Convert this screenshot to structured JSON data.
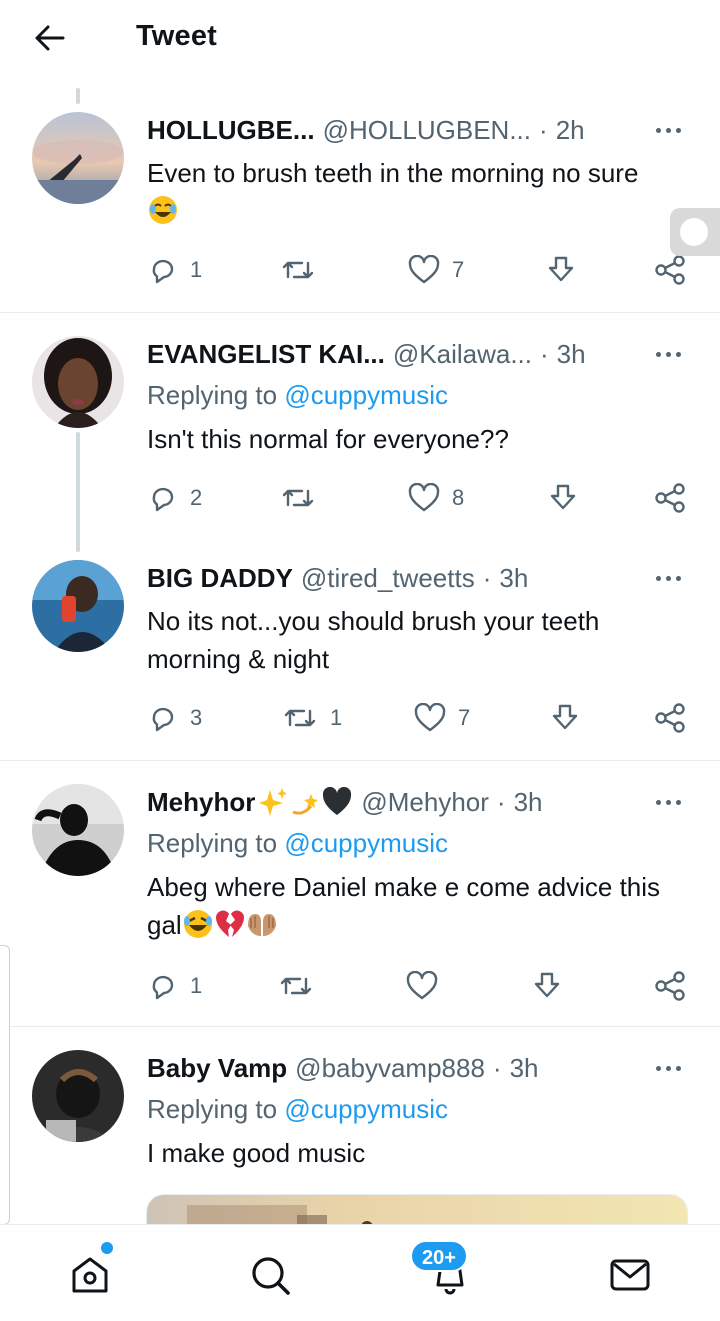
{
  "header": {
    "title": "Tweet"
  },
  "tweets": [
    {
      "name": "HOLLUGBE...",
      "handle": "@HOLLUGBEN...",
      "time": "2h",
      "text": "Even to brush teeth in the morning no sure",
      "emoji": [
        "face-with-tears-of-joy"
      ],
      "replies": "1",
      "retweets": "",
      "likes": "7"
    },
    {
      "name": "EVANGELIST KAI...",
      "handle": "@Kailawa...",
      "time": "3h",
      "replying_prefix": "Replying to",
      "replying_to": "@cuppymusic",
      "text": "Isn't this normal for everyone??",
      "replies": "2",
      "retweets": "",
      "likes": "8"
    },
    {
      "name": "BIG DADDY",
      "handle": "@tired_tweetts",
      "time": "3h",
      "text": "No its not...you should brush your teeth morning & night",
      "replies": "3",
      "retweets": "1",
      "likes": "7"
    },
    {
      "name": "Mehyhor",
      "name_emoji": [
        "sparkles",
        "dizzy",
        "black-heart"
      ],
      "handle": "@Mehyhor",
      "time": "3h",
      "replying_prefix": "Replying to",
      "replying_to": "@cuppymusic",
      "text": "Abeg where Daniel make e come advice this gal",
      "emoji": [
        "rolling-laughing-face",
        "broken-heart",
        "palms-up-together"
      ],
      "replies": "1",
      "retweets": "",
      "likes": ""
    },
    {
      "name": "Baby Vamp",
      "handle": "@babyvamp888",
      "time": "3h",
      "replying_prefix": "Replying to",
      "replying_to": "@cuppymusic",
      "text": "I make good music"
    }
  ],
  "separator": "·",
  "nav": {
    "notifications_badge": "20+"
  },
  "colors": {
    "accent": "#1d9bf0",
    "secondary_text": "#536471",
    "divider": "#e6ecf0"
  }
}
